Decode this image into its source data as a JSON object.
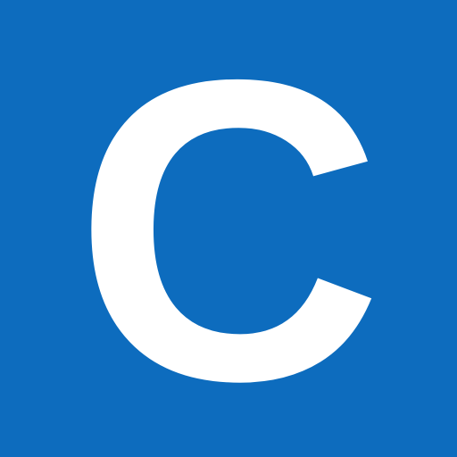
{
  "icon": {
    "letter": "C",
    "background_color": "#0d6cbe",
    "letter_color": "#ffffff"
  }
}
